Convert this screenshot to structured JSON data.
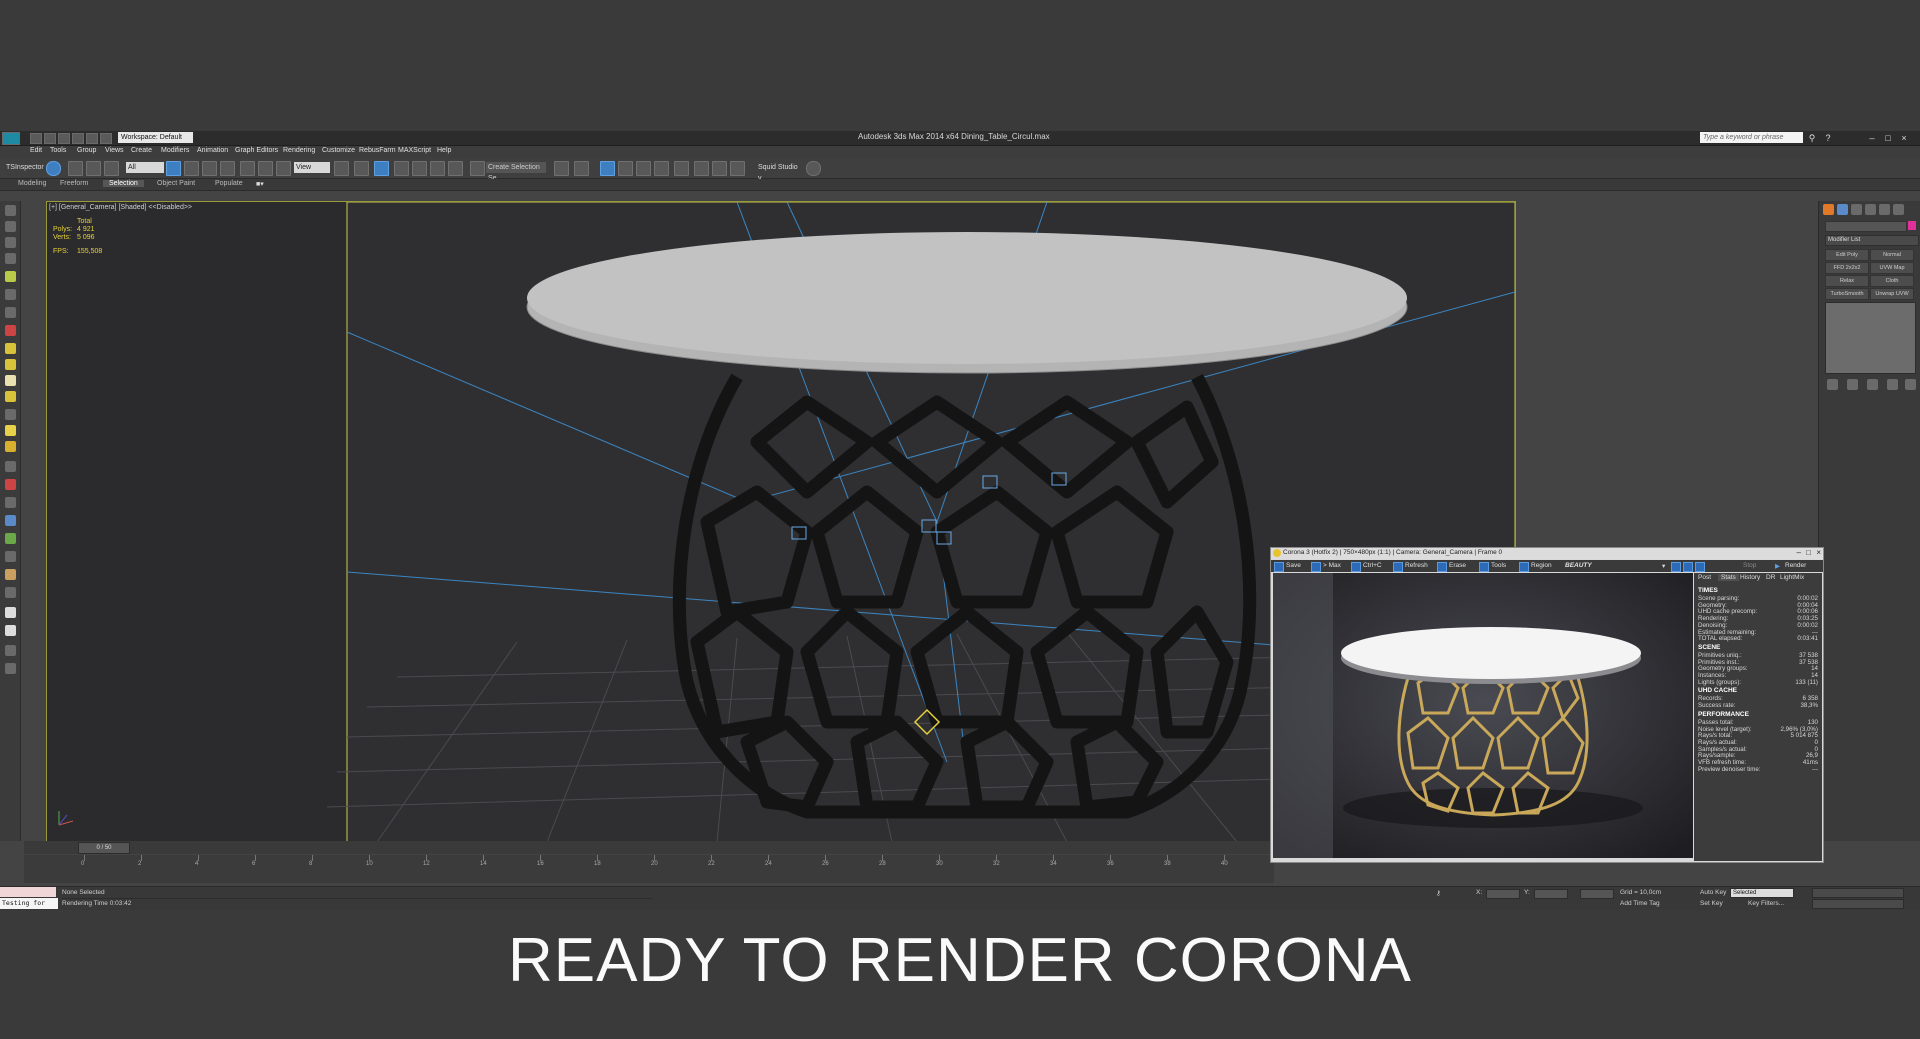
{
  "window": {
    "title": "Autodesk 3ds Max  2014 x64    Dining_Table_Circul.max",
    "workspace": "Workspace: Default",
    "search_placeholder": "Type a keyword or phrase"
  },
  "menu": [
    "Edit",
    "Tools",
    "Group",
    "Views",
    "Create",
    "Modifiers",
    "Animation",
    "Graph Editors",
    "Rendering",
    "Customize",
    "RebusFarm",
    "MAXScript",
    "Help"
  ],
  "toolbar": {
    "ts_label": "TSInspector",
    "filter": "All",
    "refcoord": "View",
    "selection_set": "Create Selection Se",
    "squid": "Squid Studio v"
  },
  "ribbon": {
    "tabs": [
      "Modeling",
      "Freeform",
      "Selection",
      "Object Paint",
      "Populate"
    ]
  },
  "viewport": {
    "label": "[+] [General_Camera] [Shaded]  <<Disabled>>",
    "stats": {
      "total": "Total",
      "polys_label": "Polys:",
      "polys": "4 921",
      "verts_label": "Verts:",
      "verts": "5 096",
      "fps_label": "FPS:",
      "fps": "155,508"
    }
  },
  "command_panel": {
    "modifier_list": "Modifier List",
    "buttons": [
      "Edit Poly",
      "Normal",
      "FFD 2x2x2",
      "UVW Map",
      "Relax",
      "Cloth",
      "TurboSmooth",
      "Unwrap UVW"
    ]
  },
  "timeline": {
    "frame": "0 / 50",
    "ticks": [
      "0",
      "2",
      "4",
      "6",
      "8",
      "10",
      "12",
      "14",
      "16",
      "18",
      "20",
      "22",
      "24",
      "26",
      "28",
      "30",
      "32",
      "34",
      "36",
      "38",
      "40"
    ]
  },
  "status": {
    "selection": "None Selected",
    "render_time": "Rendering Time  0:03:42",
    "script": "Testing for",
    "x_label": "X:",
    "y_label": "Y:",
    "grid": "Grid = 10,0cm",
    "add_time_tag": "Add Time Tag",
    "auto_key": "Auto Key",
    "selected": "Selected",
    "set_key": "Set Key",
    "key_filters": "Key Filters..."
  },
  "vfb": {
    "title": "Corona 3 (Hotfix 2) | 750×480px (1:1) | Camera: General_Camera | Frame 0",
    "toolbar": {
      "save": "Save",
      "max": "> Max",
      "ctrlc": "Ctrl+C",
      "refresh": "Refresh",
      "erase": "Erase",
      "tools": "Tools",
      "region": "Region",
      "beauty": "BEAUTY",
      "stop": "Stop",
      "render": "Render"
    },
    "tabs": [
      "Post",
      "Stats",
      "History",
      "DR",
      "LightMix"
    ],
    "sections": [
      {
        "title": "TIMES",
        "rows": [
          [
            "Scene parsing:",
            "0:00:02"
          ],
          [
            "Geometry:",
            "0:00:04"
          ],
          [
            "UHD cache precomp:",
            "0:00:06"
          ],
          [
            "Rendering:",
            "0:03:25"
          ],
          [
            "Denoising:",
            "0:00:02"
          ],
          [
            "Estimated remaining:",
            "---"
          ],
          [
            "TOTAL elapsed:",
            "0:03:41"
          ]
        ]
      },
      {
        "title": "SCENE",
        "rows": [
          [
            "Primitives uniq.:",
            "37 538"
          ],
          [
            "Primitives inst.:",
            "37 538"
          ],
          [
            "Geometry groups:",
            "14"
          ],
          [
            "Instances:",
            "14"
          ],
          [
            "Lights (groups):",
            "133 (11)"
          ]
        ]
      },
      {
        "title": "UHD CACHE",
        "rows": [
          [
            "Records:",
            "6 358"
          ],
          [
            "Success rate:",
            "38,3%"
          ]
        ]
      },
      {
        "title": "PERFORMANCE",
        "rows": [
          [
            "Passes total:",
            "130"
          ],
          [
            "Noise level (target):",
            "2,96% (3,0%)"
          ],
          [
            "Rays/s total:",
            "5 014 875"
          ],
          [
            "Rays/s actual:",
            "0"
          ],
          [
            "Samples/s actual:",
            "0"
          ],
          [
            "Rays/sample:",
            "26,9"
          ],
          [
            "VFB refresh time:",
            "41ms"
          ],
          [
            "Preview denoiser time:",
            "---"
          ]
        ]
      }
    ]
  },
  "caption": "READY TO RENDER CORONA"
}
